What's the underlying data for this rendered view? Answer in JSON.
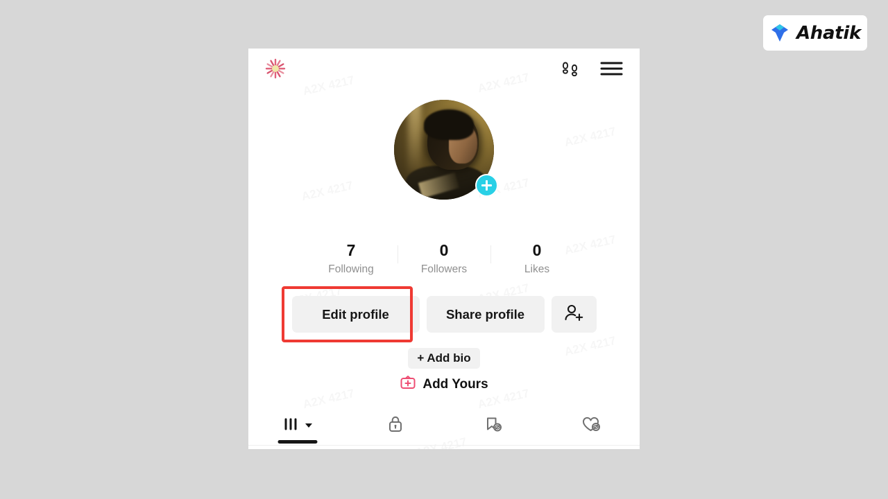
{
  "brand": {
    "name": "Ahatik",
    "logo_icon": "ahatik-diamond-logo",
    "accent_blue": "#2f6fe8",
    "accent_cyan": "#2ec6e6"
  },
  "watermark": {
    "text": "A2X 4217"
  },
  "phone": {
    "topbar": {
      "spinner_icon": "loading-spinner-icon",
      "footprints_icon": "footprints-icon",
      "menu_icon": "hamburger-menu-icon"
    },
    "profile": {
      "avatar_icon": "profile-avatar",
      "add_story_icon": "plus-icon",
      "stats": [
        {
          "value": "7",
          "label": "Following"
        },
        {
          "value": "0",
          "label": "Followers"
        },
        {
          "value": "0",
          "label": "Likes"
        }
      ]
    },
    "actions": {
      "edit_profile_label": "Edit profile",
      "share_profile_label": "Share profile",
      "add_friend_icon": "add-person-icon",
      "add_bio_label": "+ Add bio",
      "add_yours_label": "Add Yours",
      "add_yours_icon": "add-yours-sticker-icon"
    },
    "tabs": [
      {
        "icon": "grid-posts-icon",
        "active": true,
        "has_caret": true
      },
      {
        "icon": "lock-private-icon",
        "active": false,
        "has_caret": false
      },
      {
        "icon": "bookmark-hidden-icon",
        "active": false,
        "has_caret": false
      },
      {
        "icon": "heart-hidden-icon",
        "active": false,
        "has_caret": false
      }
    ]
  },
  "annotation": {
    "highlight_target": "Edit profile",
    "highlight_color": "#ef3a33"
  }
}
